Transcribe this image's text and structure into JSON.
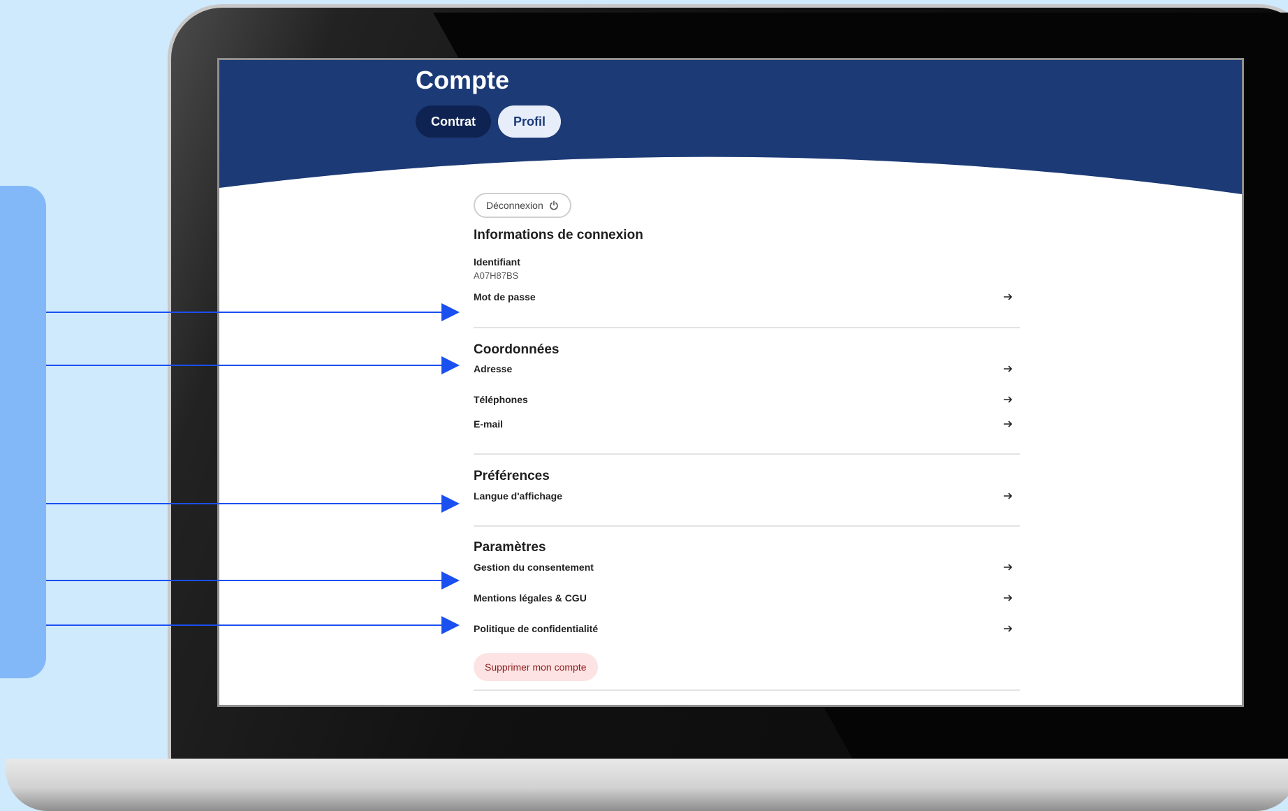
{
  "page": {
    "title": "Compte"
  },
  "tabs": [
    {
      "label": "Contrat",
      "active": false
    },
    {
      "label": "Profil",
      "active": true
    }
  ],
  "logout": {
    "label": "Déconnexion",
    "icon": "power-icon"
  },
  "sections": {
    "login_info": {
      "title": "Informations de connexion",
      "identifier_label": "Identifiant",
      "identifier_value": "A07H87BS",
      "password_label": "Mot de passe"
    },
    "contact": {
      "title": "Coordonnées",
      "items": [
        "Adresse",
        "Téléphones",
        "E-mail"
      ]
    },
    "preferences": {
      "title": "Préférences",
      "items": [
        "Langue d'affichage"
      ]
    },
    "settings": {
      "title": "Paramètres",
      "items": [
        "Gestion du consentement",
        "Mentions légales & CGU",
        "Politique de confidentialité"
      ]
    }
  },
  "delete_account": {
    "label": "Supprimer mon compte"
  },
  "colors": {
    "header_navy": "#1b3a76",
    "tab_dark": "#0f2352",
    "page_background": "#cfe9fd",
    "side_panel": "#82b8f7",
    "callout_arrow": "#1a4ff0",
    "delete_bg": "#fde3e3",
    "delete_text": "#8b1d1d"
  }
}
